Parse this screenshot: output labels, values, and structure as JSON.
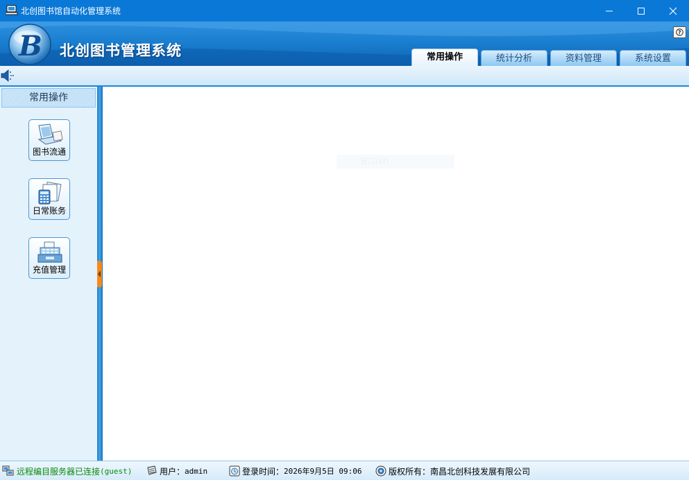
{
  "window": {
    "title": "北创图书馆自动化管理系统",
    "icons": {
      "app": "computer-icon",
      "minimize": "minimize-icon",
      "maximize": "maximize-icon",
      "close": "close-icon"
    }
  },
  "banner": {
    "logo_icon": "b-logo-icon",
    "system_title": "北创图书管理系统",
    "help_icon": "help-icon"
  },
  "tabs": [
    {
      "label": "常用操作",
      "active": true
    },
    {
      "label": "统计分析",
      "active": false
    },
    {
      "label": "资料管理",
      "active": false
    },
    {
      "label": "系统设置",
      "active": false
    }
  ],
  "toolbar": {
    "speaker_icon": "speaker-icon"
  },
  "sidebar": {
    "header": "常用操作",
    "items": [
      {
        "label": "图书流通",
        "icon": "laptop-book-icon"
      },
      {
        "label": "日常账务",
        "icon": "calculator-documents-icon"
      },
      {
        "label": "充值管理",
        "icon": "cash-register-icon"
      }
    ]
  },
  "main": {
    "ghost_text": "窗口(W)"
  },
  "statusbar": {
    "server": {
      "label": "远程编目服务器已连接",
      "user_tag": "(guest)",
      "icon": "network-icon"
    },
    "user": {
      "label": "用户：",
      "value": "admin",
      "icon": "user-icon"
    },
    "login": {
      "label": "登录时间：",
      "value": "2026年9月5日 09:06",
      "icon": "clock-icon"
    },
    "copyright": {
      "label": "版权所有：",
      "value": "南昌北创科技发展有限公司",
      "icon": "disc-icon"
    }
  },
  "colors": {
    "titlebar": "#0a78d7",
    "banner": "#1b7fd1",
    "sidebar": "#e4f2fc",
    "splitter_handle": "#f28a1e",
    "status_green": "#0a8a0a"
  }
}
